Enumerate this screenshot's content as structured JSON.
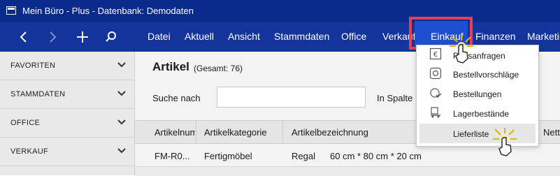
{
  "window": {
    "title": "Mein Büro - Plus - Datenbank: Demodaten"
  },
  "nav": {
    "back_icon": "chevron-left-icon",
    "forward_icon": "chevron-right-icon",
    "add_icon": "plus-icon",
    "search_icon": "search-icon"
  },
  "menu": {
    "items": [
      "Datei",
      "Aktuell",
      "Ansicht",
      "Stammdaten",
      "Office",
      "Verkauf",
      "Einkauf",
      "Finanzen",
      "Marketing"
    ],
    "active": "Einkauf"
  },
  "sidebar": {
    "items": [
      "FAVORITEN",
      "STAMMDATEN",
      "OFFICE",
      "VERKAUF"
    ]
  },
  "page": {
    "title": "Artikel",
    "count": "(Gesamt: 76)"
  },
  "search": {
    "label": "Suche nach",
    "value": "",
    "column_label": "In Spalte"
  },
  "table": {
    "columns": [
      "Artikelnummer",
      "Artikelkategorie",
      "Artikelbezeichnung",
      "Netto"
    ],
    "rows": [
      {
        "nummer": "FM-R0...",
        "kategorie": "Fertigmöbel",
        "bezeichnung": "Regal",
        "masse": "60 cm * 80 cm * 20 cm"
      }
    ]
  },
  "dropdown": {
    "items": [
      {
        "label": "Preisanfragen",
        "icon": "euro-request-icon"
      },
      {
        "label": "Bestellvorschläge",
        "icon": "order-suggestion-icon"
      },
      {
        "label": "Bestellungen",
        "icon": "orders-icon"
      },
      {
        "label": "Lagerbestände",
        "icon": "warehouse-icon"
      },
      {
        "label": "Lieferliste",
        "icon": "delivery-list-icon"
      }
    ],
    "highlighted": "Lieferliste"
  },
  "colors": {
    "titlebar": "#0a2a8c",
    "navbar": "#14349b",
    "active_menu": "#1e4fcf",
    "highlight_frame": "#e64055"
  }
}
